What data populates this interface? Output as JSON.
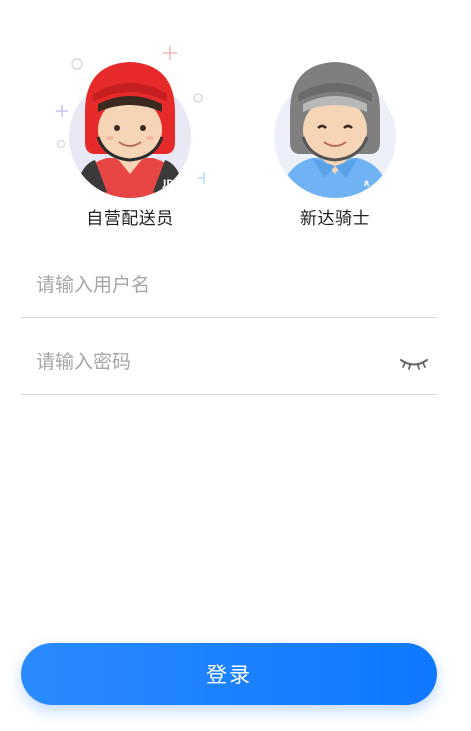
{
  "roles": [
    {
      "label": "自营配送员",
      "selected": true,
      "helmet_color": "#e62a2a",
      "shirt_color": "#e84545",
      "badge_text": "JD"
    },
    {
      "label": "新达骑士",
      "selected": false,
      "helmet_color": "#7f7f7f",
      "shirt_color": "#6fb3f5"
    }
  ],
  "username": {
    "value": "",
    "placeholder": "请输入用户名"
  },
  "password": {
    "value": "",
    "placeholder": "请输入密码",
    "toggle_icon": "eye-closed-icon"
  },
  "login": {
    "label": "登录",
    "color": "#1a82ff"
  }
}
